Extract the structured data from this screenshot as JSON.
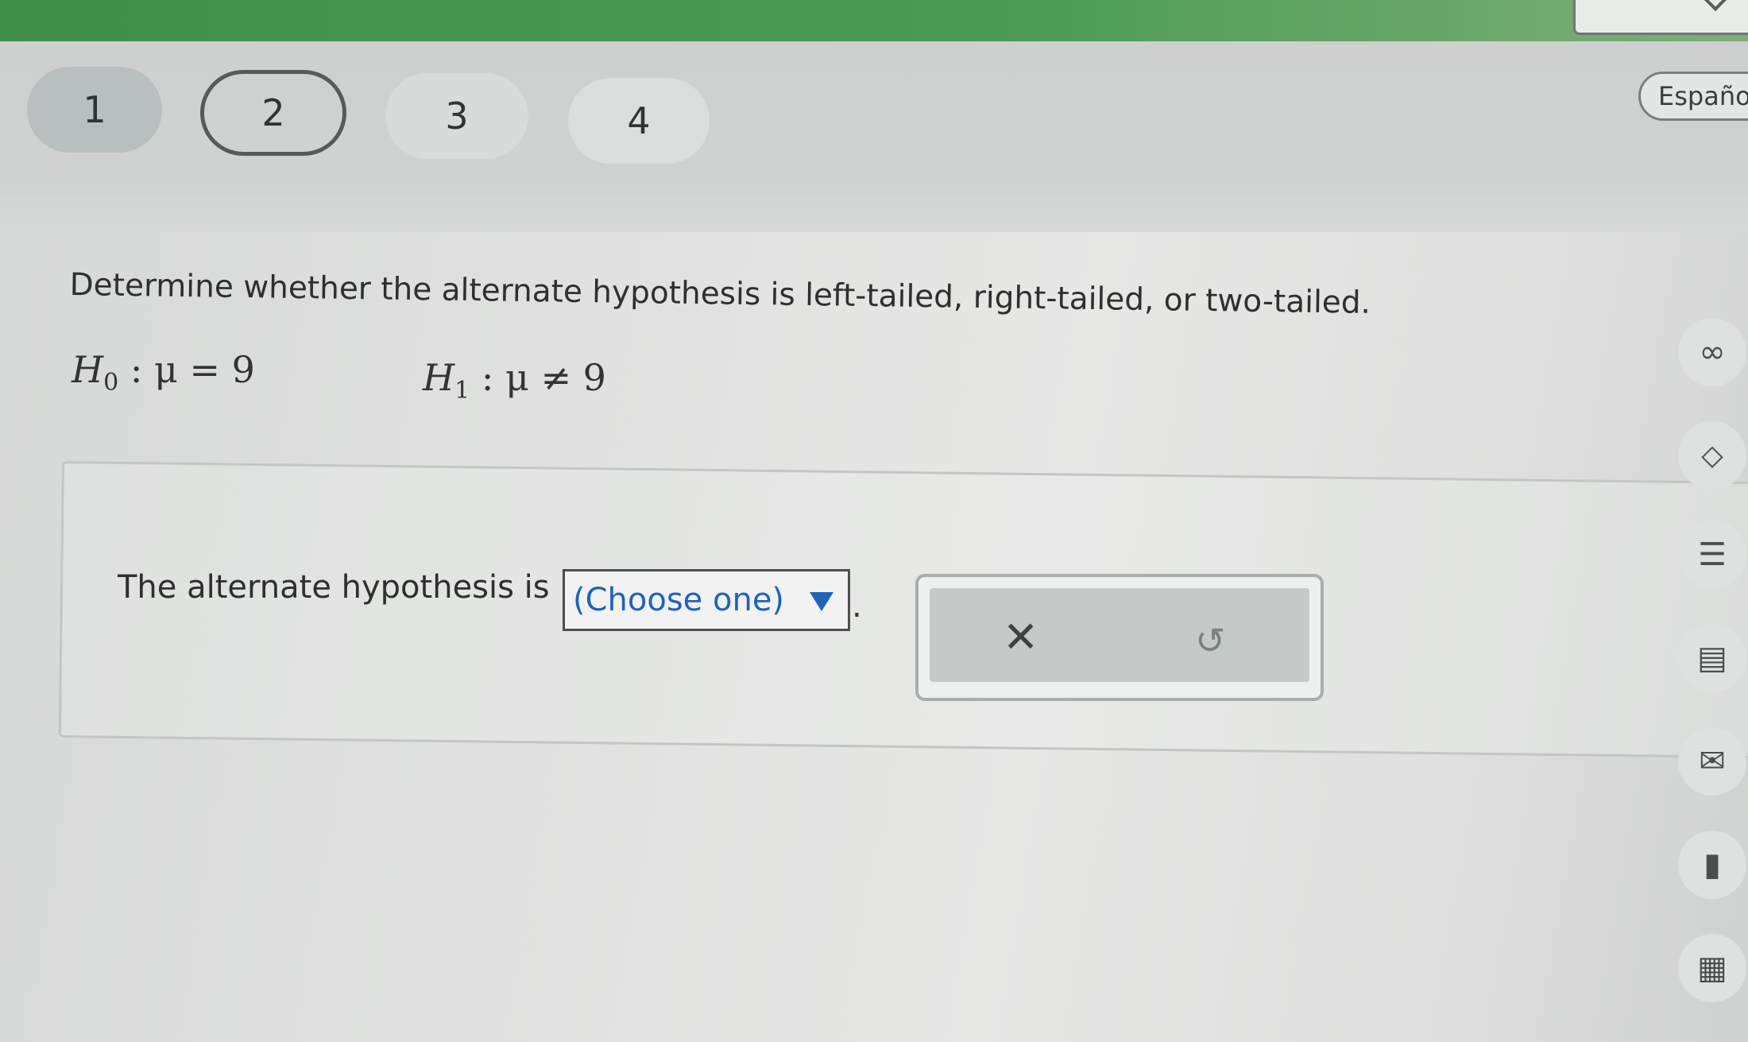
{
  "header": {
    "questions": [
      {
        "label": "1"
      },
      {
        "label": "2"
      },
      {
        "label": "3"
      },
      {
        "label": "4"
      }
    ],
    "language_button": "Español"
  },
  "problem": {
    "prompt": "Determine whether the alternate hypothesis is left-tailed, right-tailed, or two-tailed.",
    "h0": {
      "symbol": "H",
      "subscript": "0",
      "statement": " : μ = 9"
    },
    "h1": {
      "symbol": "H",
      "subscript": "1",
      "statement": " : μ ≠ 9"
    }
  },
  "answer": {
    "sentence": "The alternate hypothesis is",
    "dropdown_selected": "(Choose one)",
    "period": "."
  },
  "actions": {
    "clear_symbol": "✕",
    "undo_symbol": "↺"
  },
  "tools": [
    {
      "icon": "glasses-icon",
      "glyph": "∞"
    },
    {
      "icon": "direction-icon",
      "glyph": "⬦"
    },
    {
      "icon": "textbook-icon",
      "glyph": "☰"
    },
    {
      "icon": "calculator-icon",
      "glyph": "▤"
    },
    {
      "icon": "mail-icon",
      "glyph": "✉"
    },
    {
      "icon": "chart-icon",
      "glyph": "▮"
    },
    {
      "icon": "formula-icon",
      "glyph": "▦"
    }
  ]
}
